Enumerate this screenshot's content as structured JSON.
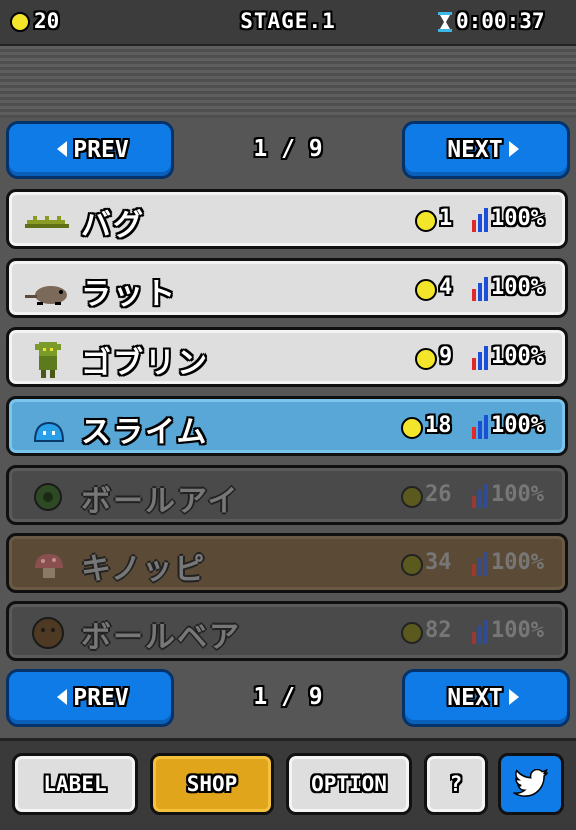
{
  "topbar": {
    "gold": "20",
    "stage": "STAGE.1",
    "timer": "0:00:37"
  },
  "nav": {
    "prev_label": "PREV",
    "next_label": "NEXT",
    "page_indicator": "1 / 9"
  },
  "items": [
    {
      "name": "バグ",
      "price": "1",
      "percent": "100%",
      "state": "unlocked"
    },
    {
      "name": "ラット",
      "price": "4",
      "percent": "100%",
      "state": "unlocked"
    },
    {
      "name": "ゴブリン",
      "price": "9",
      "percent": "100%",
      "state": "unlocked"
    },
    {
      "name": "スライム",
      "price": "18",
      "percent": "100%",
      "state": "selected"
    },
    {
      "name": "ボールアイ",
      "price": "26",
      "percent": "100%",
      "state": "locked"
    },
    {
      "name": "キノッピ",
      "price": "34",
      "percent": "100%",
      "state": "locked"
    },
    {
      "name": "ボールベア",
      "price": "82",
      "percent": "100%",
      "state": "locked"
    }
  ],
  "bottom": {
    "label_tab": "LABEL",
    "shop_tab": "SHOP",
    "option_tab": "OPTION",
    "help_tab": "?"
  },
  "icons": [
    "coin-icon",
    "hourglass-icon",
    "arrow-left-icon",
    "arrow-right-icon",
    "bar-chart-icon",
    "twitter-bird-icon"
  ],
  "colors": {
    "accent_blue": "#0f7be6",
    "shop_gold": "#e1a51c",
    "selected_row": "#58a7d7",
    "coin": "#f2e52a"
  }
}
